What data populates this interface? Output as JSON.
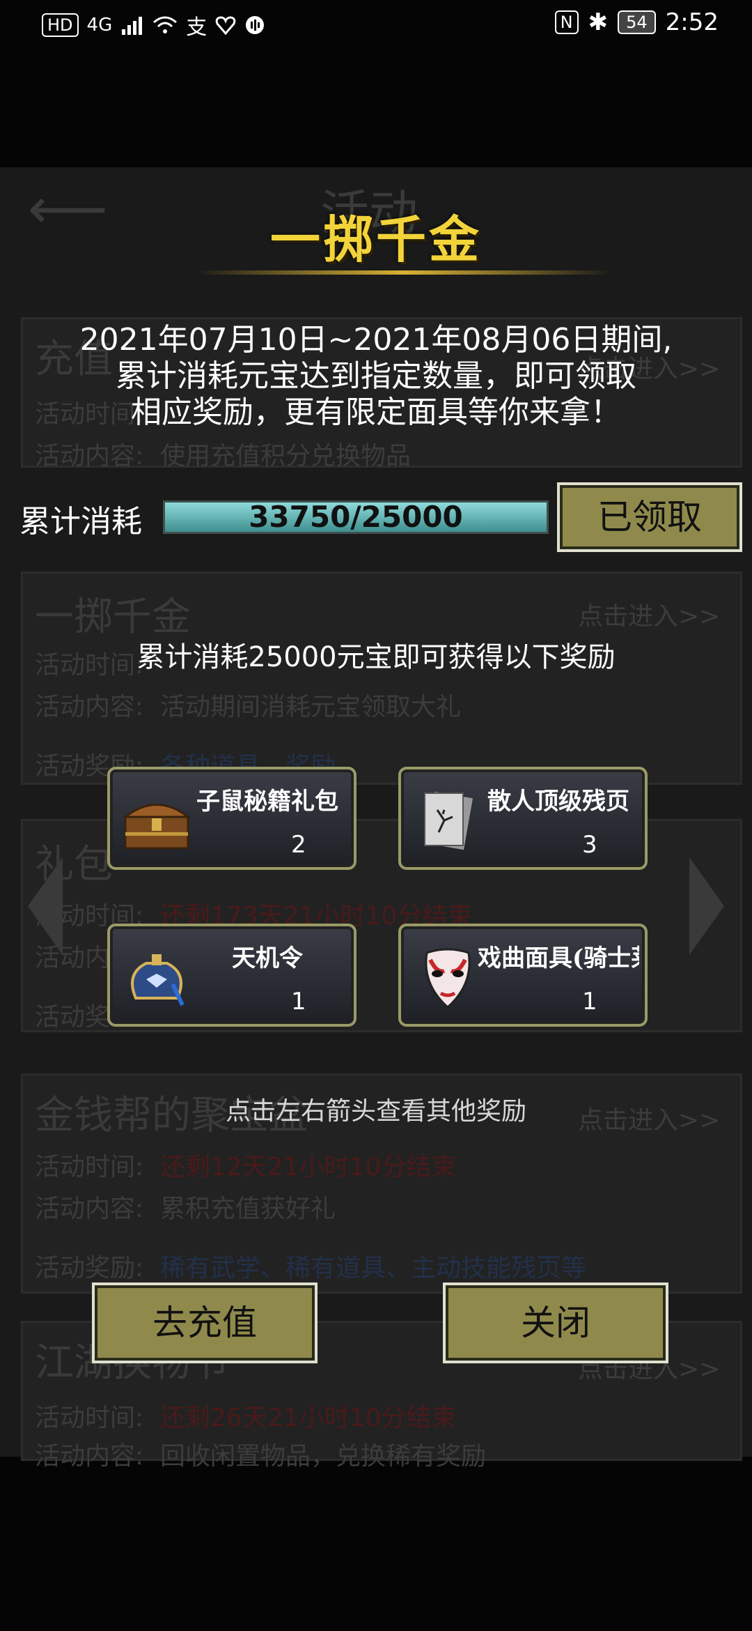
{
  "status_bar": {
    "left_icons": [
      "HD",
      "4G",
      "signal-icon",
      "wifi-icon",
      "alipay-icon",
      "heart-icon",
      "audio-icon"
    ],
    "hd": "HD",
    "network": "4G",
    "nfc": "N",
    "battery": "54",
    "time": "2:52"
  },
  "background": {
    "title": "活动",
    "items": [
      {
        "title": "充值",
        "time_label": "活动时间:",
        "content_label": "活动内容:",
        "content": "使用充值积分兑换物品",
        "link": "点击进入>>"
      },
      {
        "title": "一掷千金",
        "time_label": "活动时间:",
        "content_label": "活动内容:",
        "content": "活动期间消耗元宝领取大礼",
        "reward_label": "活动奖励:",
        "reward": "各种道具、奖励",
        "link": "点击进入>>"
      },
      {
        "title": "礼包",
        "time_label": "活动时间:",
        "time": "还剩173天21小时10分结束",
        "content_label": "活动内",
        "reward_label": "活动奖"
      },
      {
        "title": "金钱帮的聚宝盆",
        "time_label": "活动时间:",
        "time": "还剩12天21小时10分结束",
        "content_label": "活动内容:",
        "content": "累积充值获好礼",
        "reward_label": "活动奖励:",
        "reward": "稀有武学、稀有道具、主动技能残页等",
        "link": "点击进入>>"
      },
      {
        "title": "江湖换物节",
        "time_label": "活动时间:",
        "time": "还剩26天21小时10分结束",
        "content_label": "活动内容:",
        "content": "回收闲置物品，兑换稀有奖励",
        "link": "点击进入>>"
      }
    ]
  },
  "modal": {
    "title": "一掷千金",
    "description": [
      "2021年07月10日~2021年08月06日期间,",
      "累计消耗元宝达到指定数量，即可领取",
      "相应奖励，更有限定面具等你来拿！"
    ],
    "progress_label": "累计消耗",
    "progress_text": "33750/25000",
    "progress_fraction": 1.0,
    "claim_button": "已领取",
    "reward_caption": "累计消耗25000元宝即可获得以下奖励",
    "rewards": [
      {
        "name": "子鼠秘籍礼包",
        "count": "2",
        "icon": "treasure-chest-icon"
      },
      {
        "name": "散人顶级残页",
        "count": "3",
        "icon": "scroll-pages-icon"
      },
      {
        "name": "天机令",
        "count": "1",
        "icon": "token-pouch-icon"
      },
      {
        "name": "戏曲面具(骑士莱恩)",
        "count": "1",
        "icon": "opera-mask-icon"
      }
    ],
    "hint": "点击左右箭头查看其他奖励",
    "recharge_button": "去充值",
    "close_button": "关闭"
  }
}
